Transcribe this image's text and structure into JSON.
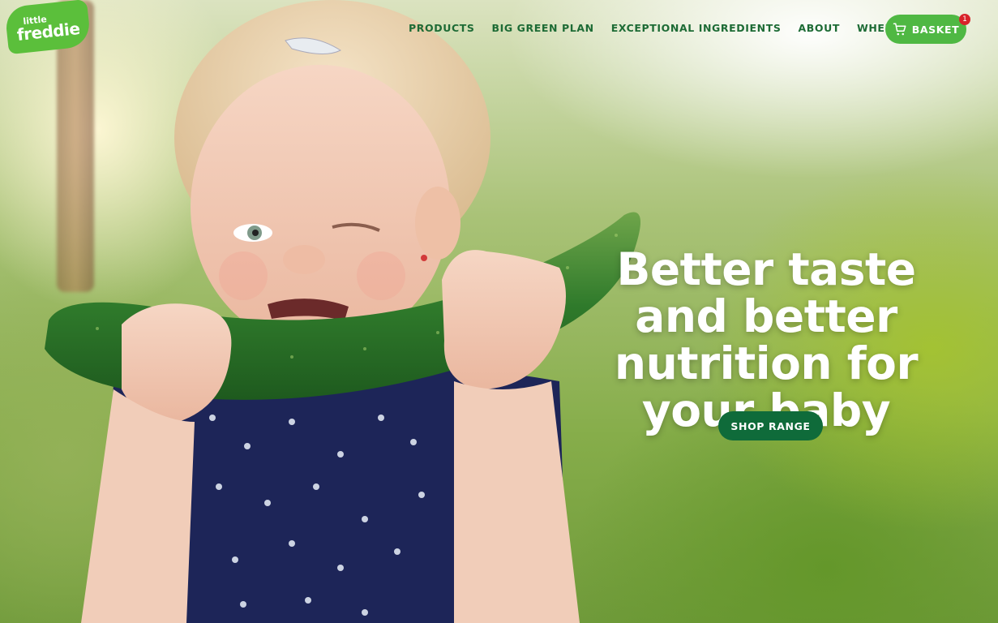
{
  "brand": {
    "logo_line1": "little",
    "logo_line2": "freddie",
    "color": "#5bbf3b"
  },
  "nav": {
    "items": [
      {
        "label": "PRODUCTS"
      },
      {
        "label": "BIG GREEN PLAN"
      },
      {
        "label": "EXCEPTIONAL INGREDIENTS"
      },
      {
        "label": "ABOUT"
      },
      {
        "label": "WHERE TO BUY"
      }
    ],
    "color": "#1d6b35"
  },
  "basket": {
    "label": "BASKET",
    "count": "1",
    "icon": "cart-icon",
    "color": "#4fb843",
    "badge_color": "#d8232a"
  },
  "hero": {
    "headline": "Better taste and better nutrition for your baby",
    "cta_label": "SHOP RANGE",
    "cta_color": "#0f6b3a"
  }
}
